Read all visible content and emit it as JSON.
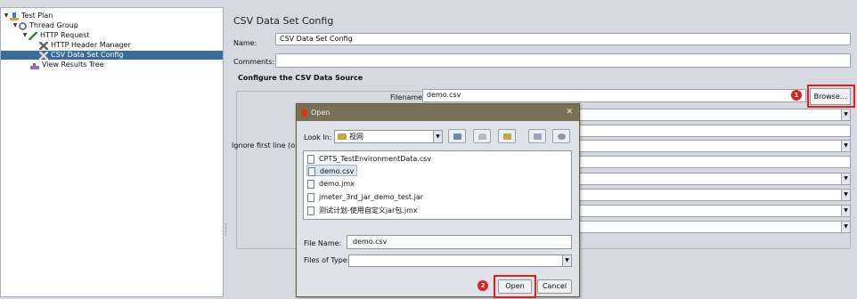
{
  "tree": {
    "items": [
      {
        "label": "Test Plan"
      },
      {
        "label": "Thread Group"
      },
      {
        "label": "HTTP Request"
      },
      {
        "label": "HTTP Header Manager"
      },
      {
        "label": "CSV Data Set Config"
      },
      {
        "label": "View Results Tree"
      }
    ],
    "selected": "CSV Data Set Config"
  },
  "panel": {
    "title": "CSV Data Set Config",
    "name_label": "Name:",
    "name_value": "CSV Data Set Config",
    "comments_label": "Comments:",
    "comments_value": "",
    "group_title": "Configure the CSV Data Source",
    "filename_label": "Filename:",
    "filename_value": "demo.csv",
    "browse_label": "Browse...",
    "ignore_label": "Ignore first line (o"
  },
  "dialog": {
    "title": "Open",
    "close_glyph": "✕",
    "lookin_label": "Look In:",
    "lookin_value": "视网",
    "files": [
      "CPTS_TestEnvironmentData.csv",
      "demo.csv",
      "demo.jmx",
      "jmeter_3rd_jar_demo_test.jar",
      "测试计划-使用自定义jar包.jmx"
    ],
    "selected_file": "demo.csv",
    "filename_label": "File Name:",
    "filename_value": "demo.csv",
    "filetype_label": "Files of Type:",
    "filetype_value": "",
    "open_label": "Open",
    "cancel_label": "Cancel"
  },
  "annotations": {
    "badge_1": "1",
    "badge_2": "2",
    "color": "#e02020"
  },
  "colors": {
    "selection": "#3a6b9d",
    "dialog_title": "#777255",
    "panel_bg": "#d6d9df"
  }
}
